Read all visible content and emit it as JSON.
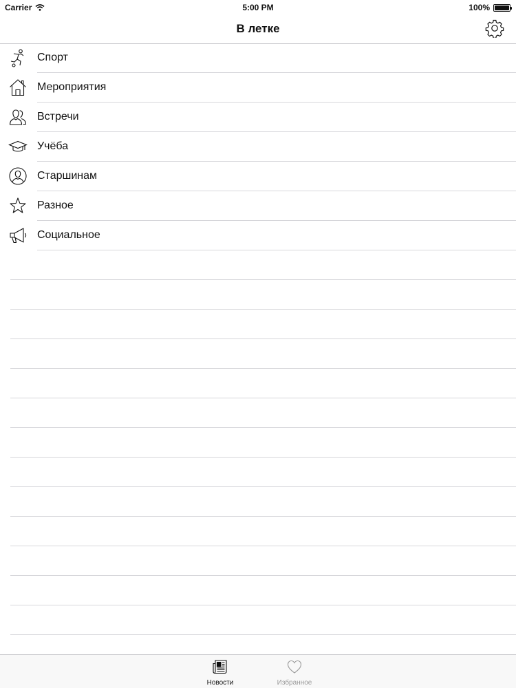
{
  "status_bar": {
    "carrier": "Carrier",
    "time": "5:00 PM",
    "battery": "100%"
  },
  "nav": {
    "title": "В летке",
    "settings_icon": "gear-icon"
  },
  "categories": [
    {
      "label": "Спорт",
      "icon": "soccer-player-icon"
    },
    {
      "label": "Мероприятия",
      "icon": "house-icon"
    },
    {
      "label": "Встречи",
      "icon": "people-icon"
    },
    {
      "label": "Учёба",
      "icon": "graduation-cap-icon"
    },
    {
      "label": "Старшинам",
      "icon": "user-circle-icon"
    },
    {
      "label": "Разное",
      "icon": "star-icon"
    },
    {
      "label": "Социальное",
      "icon": "megaphone-icon"
    }
  ],
  "tabs": [
    {
      "label": "Новости",
      "icon": "newspaper-icon",
      "active": true
    },
    {
      "label": "Избранное",
      "icon": "heart-icon",
      "active": false
    }
  ],
  "colors": {
    "text": "#111111",
    "separator": "#d6d6da",
    "inactive_tab": "#9a9a9a",
    "tab_bar_bg": "#f8f8f8"
  }
}
